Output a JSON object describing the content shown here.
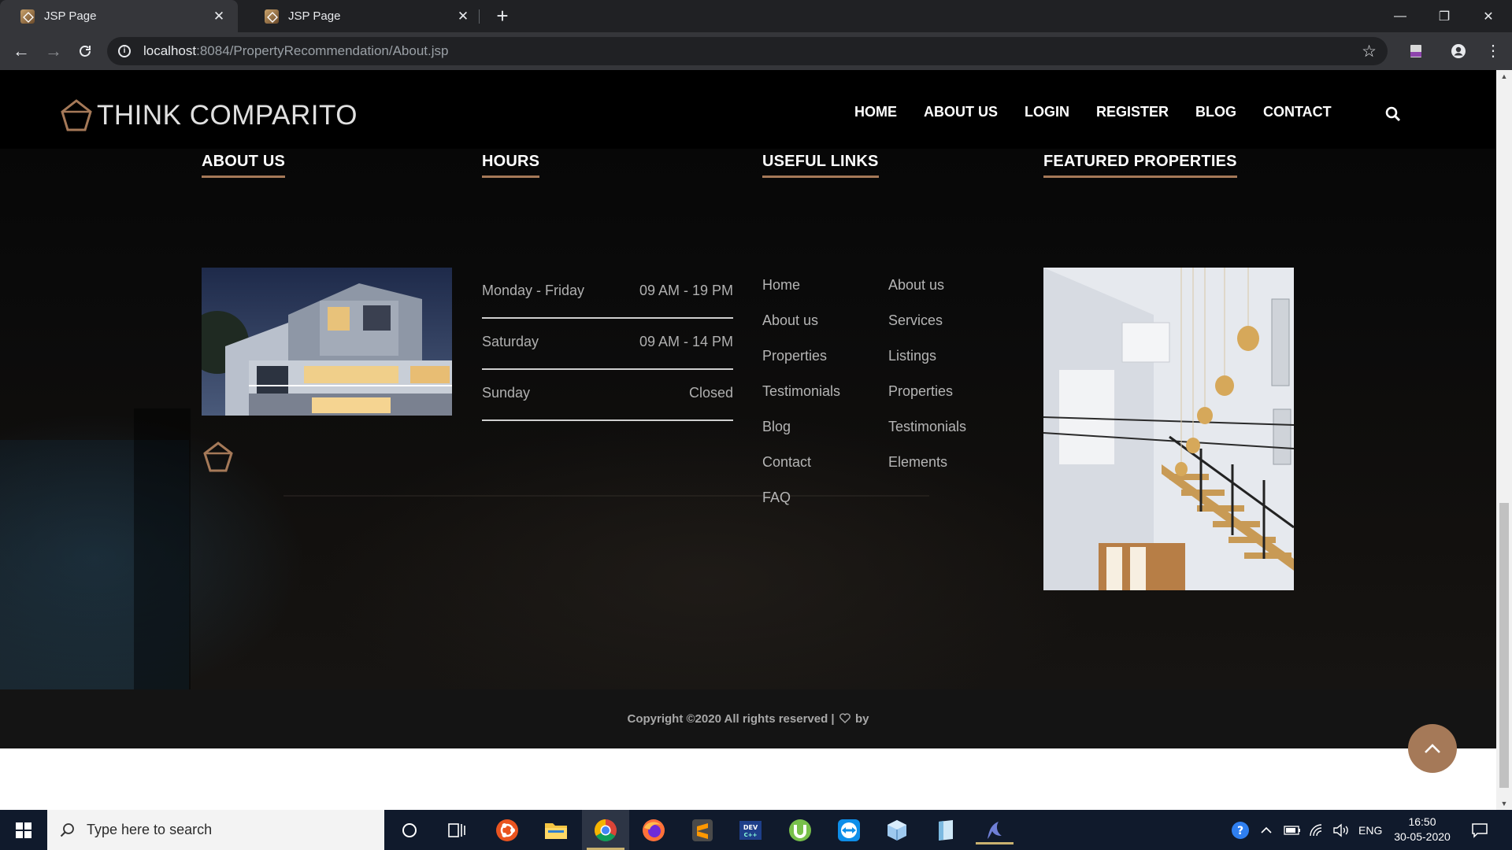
{
  "browser": {
    "tabs": [
      {
        "title": "JSP Page",
        "active": true
      },
      {
        "title": "JSP Page",
        "active": false
      }
    ],
    "url_host": "localhost",
    "url_path": ":8084/PropertyRecommendation/About.jsp"
  },
  "site": {
    "brand": "THINK COMPARITO",
    "nav": [
      "HOME",
      "ABOUT US",
      "LOGIN",
      "REGISTER",
      "BLOG",
      "CONTACT"
    ],
    "accent_color": "#a57958"
  },
  "footer": {
    "about_title": "ABOUT US",
    "hours_title": "HOURS",
    "links_title": "USEFUL LINKS",
    "featured_title": "FEATURED PROPERTIES",
    "hours": [
      {
        "day": "Monday - Friday",
        "time": "09 AM - 19 PM"
      },
      {
        "day": "Saturday",
        "time": "09 AM - 14 PM"
      },
      {
        "day": "Sunday",
        "time": "Closed"
      }
    ],
    "links_col1": [
      "Home",
      "About us",
      "Properties",
      "Testimonials",
      "Blog",
      "Contact",
      "FAQ"
    ],
    "links_col2": [
      "About us",
      "Services",
      "Listings",
      "Properties",
      "Testimonials",
      "Elements"
    ],
    "copyright": "Copyright ©2020 All rights reserved |",
    "by": "by"
  },
  "taskbar": {
    "search_placeholder": "Type here to search",
    "language": "ENG",
    "time": "16:50",
    "date": "30-05-2020"
  }
}
